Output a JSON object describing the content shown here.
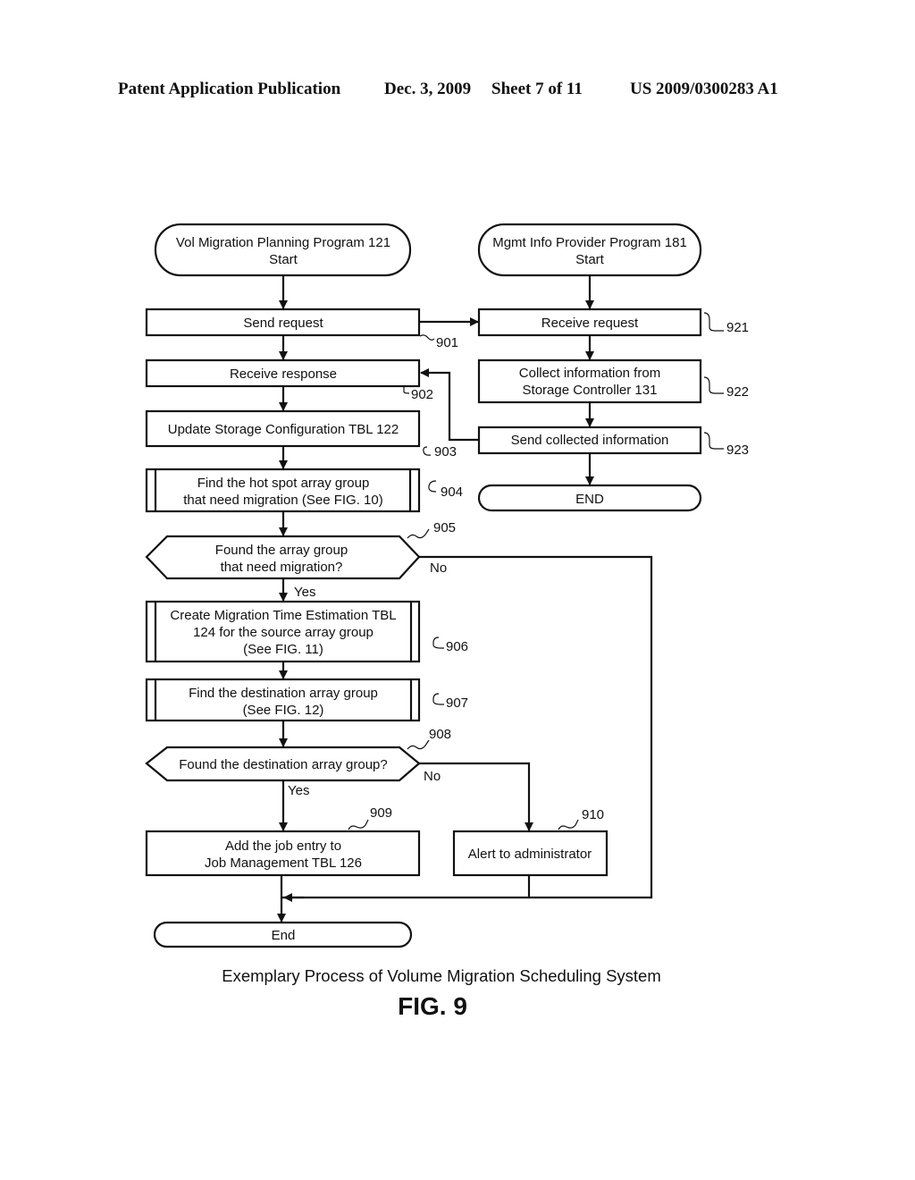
{
  "header": {
    "publication": "Patent Application Publication",
    "date": "Dec. 3, 2009",
    "sheet": "Sheet 7 of 11",
    "number": "US 2009/0300283 A1"
  },
  "flow": {
    "left_start": [
      "Vol Migration Planning Program 121",
      "Start"
    ],
    "right_start": [
      "Mgmt Info Provider Program 181",
      "Start"
    ],
    "s901": {
      "lines": [
        "Send request"
      ],
      "ref": "901"
    },
    "s902": {
      "lines": [
        "Receive response"
      ],
      "ref": "902"
    },
    "s903": {
      "lines": [
        "Update Storage Configuration TBL 122"
      ],
      "ref": "903"
    },
    "s904": {
      "lines": [
        "Find the hot spot array group",
        "that need migration (See FIG. 10)"
      ],
      "ref": "904"
    },
    "s905": {
      "lines": [
        "Found the array group",
        "that need migration?"
      ],
      "ref": "905",
      "yes": "Yes",
      "no": "No"
    },
    "s906": {
      "lines": [
        "Create Migration Time Estimation TBL",
        "124 for the source array group",
        "(See FIG. 11)"
      ],
      "ref": "906"
    },
    "s907": {
      "lines": [
        "Find the destination array group",
        "(See FIG. 12)"
      ],
      "ref": "907"
    },
    "s908": {
      "lines": [
        "Found the destination array group?"
      ],
      "ref": "908",
      "yes": "Yes",
      "no": "No"
    },
    "s909": {
      "lines": [
        "Add the job entry to",
        "Job Management TBL 126"
      ],
      "ref": "909"
    },
    "s910": {
      "lines": [
        "Alert to administrator"
      ],
      "ref": "910"
    },
    "s921": {
      "lines": [
        "Receive request"
      ],
      "ref": "921"
    },
    "s922": {
      "lines": [
        "Collect information from",
        "Storage Controller 131"
      ],
      "ref": "922"
    },
    "s923": {
      "lines": [
        "Send collected information"
      ],
      "ref": "923"
    },
    "right_end": "END",
    "left_end": "End"
  },
  "caption": "Exemplary Process of Volume Migration Scheduling System",
  "figure_label": "FIG. 9"
}
